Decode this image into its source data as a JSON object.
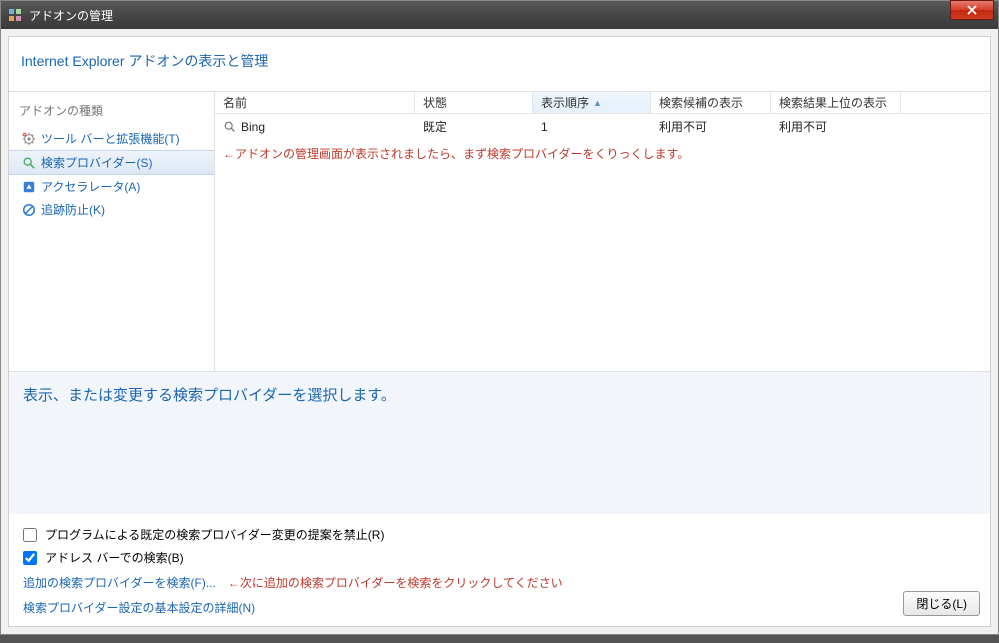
{
  "window": {
    "title": "アドオンの管理"
  },
  "header": {
    "title": "Internet Explorer アドオンの表示と管理"
  },
  "sidebar": {
    "heading": "アドオンの種類",
    "items": [
      {
        "label": "ツール バーと拡張機能(T)",
        "icon": "gear"
      },
      {
        "label": "検索プロバイダー(S)",
        "icon": "search",
        "selected": true
      },
      {
        "label": "アクセラレータ(A)",
        "icon": "accelerator"
      },
      {
        "label": "追跡防止(K)",
        "icon": "block"
      }
    ]
  },
  "table": {
    "columns": {
      "name": "名前",
      "status": "状態",
      "order": "表示順序",
      "suggest": "検索候補の表示",
      "top": "検索結果上位の表示"
    },
    "rows": [
      {
        "name": "Bing",
        "status": "既定",
        "order": "1",
        "suggest": "利用不可",
        "top": "利用不可"
      }
    ],
    "annotation": "←アドオンの管理画面が表示されましたら、まず検索プロバイダーをくりっくします。"
  },
  "detail": {
    "message": "表示、または変更する検索プロバイダーを選択します。"
  },
  "bottom": {
    "checkbox1": {
      "label": "プログラムによる既定の検索プロバイダー変更の提案を禁止(R)",
      "checked": false
    },
    "checkbox2": {
      "label": "アドレス バーでの検索(B)",
      "checked": true
    },
    "link1": "追加の検索プロバイダーを検索(F)...",
    "link1_annotation": "←次に追加の検索プロバイダーを検索をクリックしてください",
    "link2": "検索プロバイダー設定の基本設定の詳細(N)",
    "close_button": "閉じる(L)"
  }
}
